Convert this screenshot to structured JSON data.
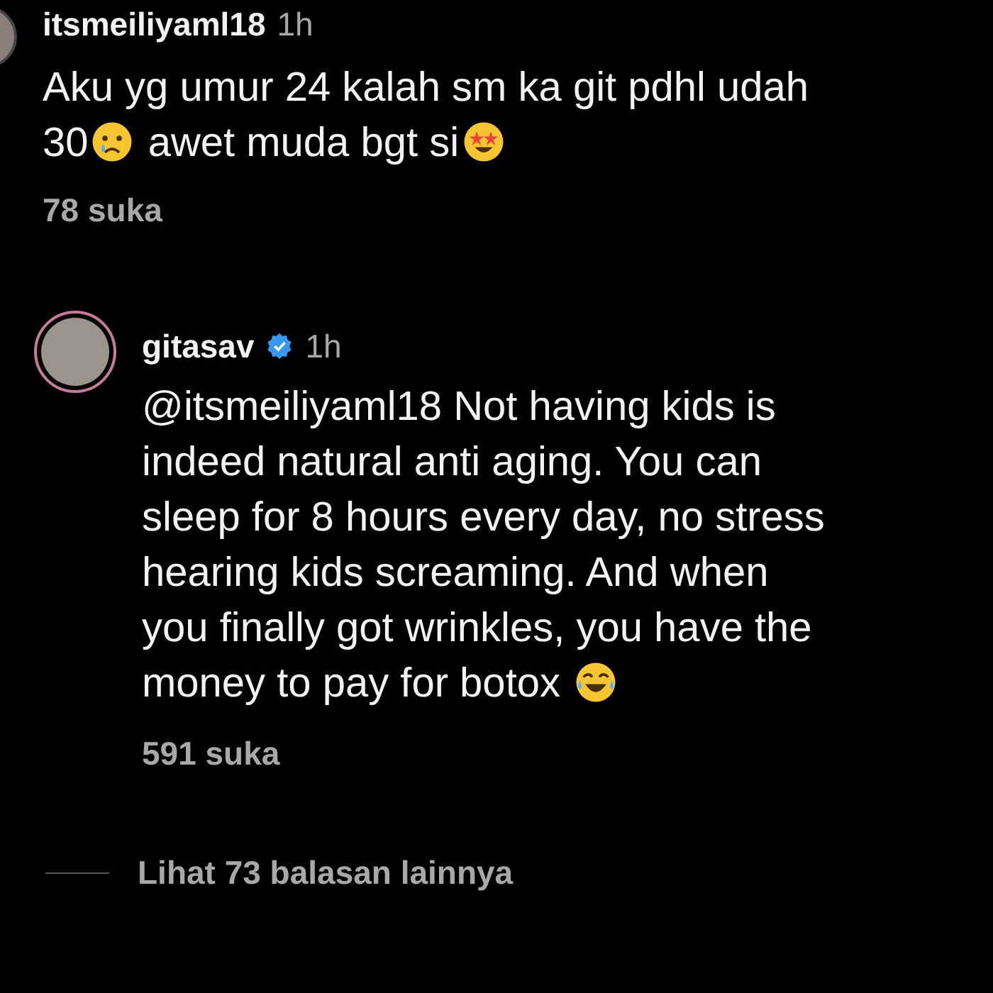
{
  "comment": {
    "username": "itsmeiliyaml18",
    "time": "1h",
    "lines": [
      [
        {
          "kind": "text",
          "text": "Aku yg umur 24 kalah sm ka git pdhl udah"
        }
      ],
      [
        {
          "kind": "text",
          "text": "30"
        },
        {
          "kind": "crying"
        },
        {
          "kind": "text",
          "text": " awet muda bgt si"
        },
        {
          "kind": "starstruck"
        }
      ]
    ],
    "likes": "78 suka"
  },
  "reply": {
    "username": "gitasav",
    "time": "1h",
    "verified": true,
    "lines": [
      [
        {
          "kind": "text",
          "text": "@itsmeiliyaml18 Not having kids is"
        }
      ],
      [
        {
          "kind": "text",
          "text": "indeed natural anti aging. You can"
        }
      ],
      [
        {
          "kind": "text",
          "text": "sleep for 8 hours every day, no stress"
        }
      ],
      [
        {
          "kind": "text",
          "text": "hearing kids screaming. And when"
        }
      ],
      [
        {
          "kind": "text",
          "text": "you finally got wrinkles, you have the"
        }
      ],
      [
        {
          "kind": "text",
          "text": "money to pay for botox "
        },
        {
          "kind": "laughing"
        }
      ]
    ],
    "likes": "591 suka"
  },
  "view_replies": "Lihat 73 balasan lainnya"
}
